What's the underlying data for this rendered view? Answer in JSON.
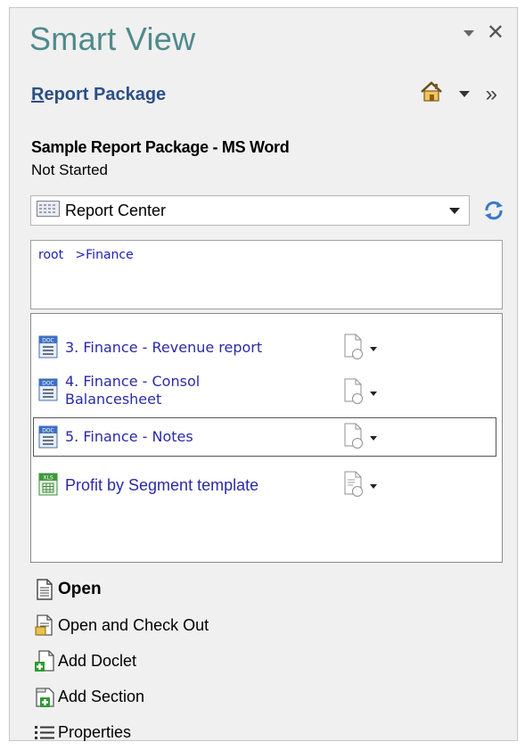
{
  "panel": {
    "title": "Smart View"
  },
  "report_package": {
    "label_first": "R",
    "label_rest": "eport Package",
    "home_icon": "home-icon",
    "more_icon": "double-chevron-right-icon"
  },
  "package": {
    "name": "Sample Report Package - MS Word",
    "status": "Not Started"
  },
  "combo": {
    "value": "Report Center"
  },
  "breadcrumb": {
    "text": "root   >Finance"
  },
  "items": [
    {
      "label": "3. Finance - Revenue report",
      "type": "DOC",
      "selected": false
    },
    {
      "label_line1": "4. Finance - Consol",
      "label_line2": "Balancesheet",
      "type": "DOC",
      "selected": false
    },
    {
      "label": "5. Finance - Notes",
      "type": "DOC",
      "selected": true
    },
    {
      "label": "Profit by Segment template",
      "type": "XLS",
      "selected": false
    }
  ],
  "actions": {
    "open": "Open",
    "open_checkout": "Open and Check Out",
    "add_doclet": "Add Doclet",
    "add_section": "Add Section",
    "properties": "Properties"
  },
  "colors": {
    "title": "#4f8a8b",
    "rp_title": "#2b4f86",
    "item_text": "#2a2aa8",
    "crumb_text": "#2020c0"
  }
}
